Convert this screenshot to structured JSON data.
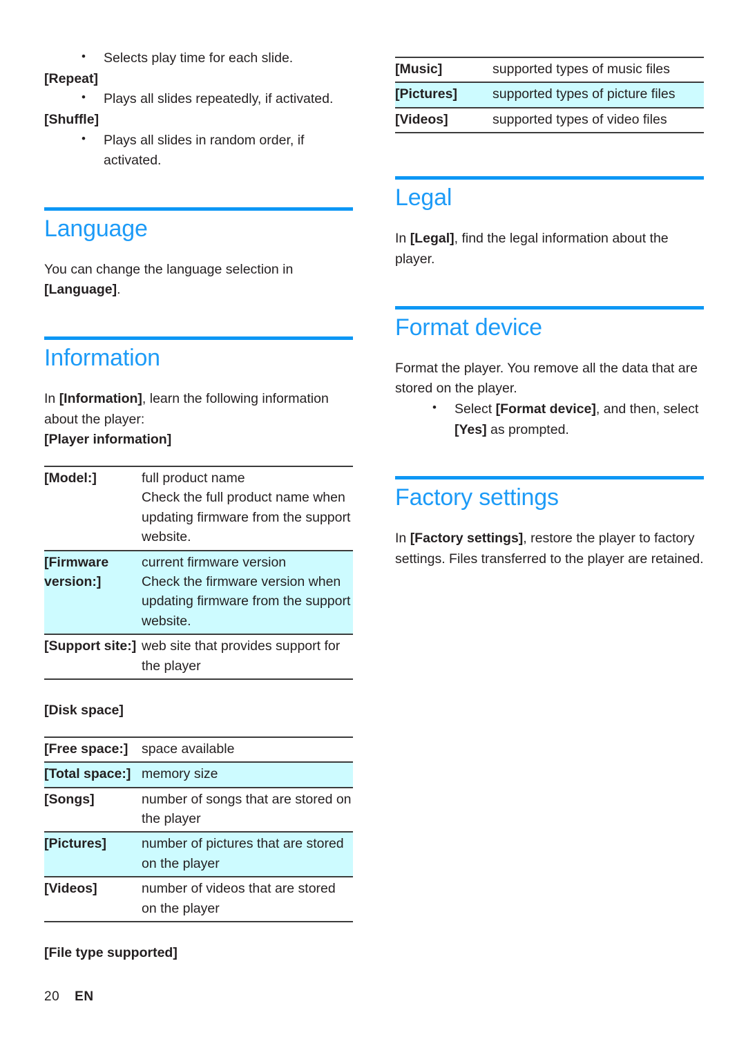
{
  "colors": {
    "heading_blue": "#1d9bf7",
    "rule_blue": "#0d97f5",
    "row_highlight": "#cdfbff",
    "text": "#231f20"
  },
  "footer": {
    "page_number": "20",
    "language_code": "EN"
  },
  "left_column": {
    "slideshow_options": {
      "bullet_play_time": "Selects play time for each slide.",
      "repeat_label": "[Repeat]",
      "bullet_repeat": "Plays all slides repeatedly, if activated.",
      "shuffle_label": "[Shuffle]",
      "bullet_shuffle": "Plays all slides in random order, if activated."
    },
    "language_section": {
      "heading": "Language",
      "body_pre": "You can change the language selection in ",
      "body_bold": "[Language]",
      "body_post": "."
    },
    "information_section": {
      "heading": "Information",
      "intro_pre": "In ",
      "intro_bold": "[Information]",
      "intro_post": ", learn the following information about the player:",
      "player_info_label": "[Player information]",
      "player_info_rows": [
        {
          "key": "[Model:]",
          "value": "full product name\nCheck the full product name when updating firmware from the support website.",
          "highlight": false
        },
        {
          "key": "[Firmware version:]",
          "value": "current firmware version\nCheck the firmware version when updating firmware from the support website.",
          "highlight": true
        },
        {
          "key": "[Support site:]",
          "value": "web site that provides support for the player",
          "highlight": false
        }
      ],
      "disk_space_label": "[Disk space]",
      "disk_space_rows": [
        {
          "key": "[Free space:]",
          "value": "space available",
          "highlight": false
        },
        {
          "key": "[Total space:]",
          "value": "memory size",
          "highlight": true
        },
        {
          "key": "[Songs]",
          "value": "number of songs that are stored on the player",
          "highlight": false
        },
        {
          "key": "[Pictures]",
          "value": "number of pictures that are stored on the player",
          "highlight": true
        },
        {
          "key": "[Videos]",
          "value": "number of videos that are stored on the player",
          "highlight": false
        }
      ],
      "file_type_label": "[File type supported]"
    }
  },
  "right_column": {
    "file_type_rows": [
      {
        "key": "[Music]",
        "value": "supported types of music files",
        "highlight": false
      },
      {
        "key": "[Pictures]",
        "value": "supported types of picture files",
        "highlight": true
      },
      {
        "key": "[Videos]",
        "value": "supported types of video files",
        "highlight": false
      }
    ],
    "legal_section": {
      "heading": "Legal",
      "body_pre": "In ",
      "body_bold": "[Legal]",
      "body_post": ", find the legal information about the player."
    },
    "format_section": {
      "heading": "Format device",
      "body": "Format the player. You remove all the data that are stored on the player.",
      "bullet_pre": "Select ",
      "bullet_bold1": "[Format device]",
      "bullet_mid": ", and then, select ",
      "bullet_bold2": "[Yes]",
      "bullet_post": " as prompted."
    },
    "factory_section": {
      "heading": "Factory settings",
      "body_pre": "In ",
      "body_bold": "[Factory settings]",
      "body_post": ", restore the player to factory settings. Files transferred to the player are retained."
    }
  }
}
